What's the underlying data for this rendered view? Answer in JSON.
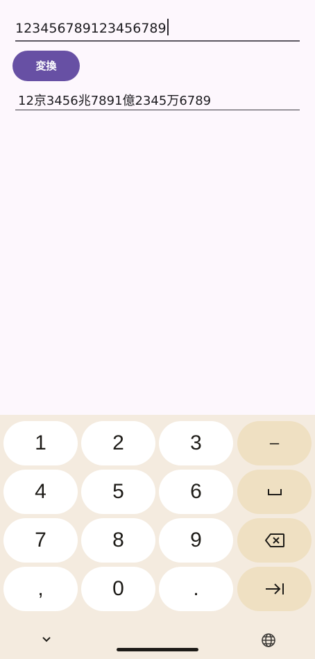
{
  "app": {
    "input_value": "123456789123456789",
    "convert_label": "変換",
    "output_value": "12京3456兆7891億2345万6789"
  },
  "keyboard": {
    "rows": [
      [
        "1",
        "2",
        "3",
        "−"
      ],
      [
        "4",
        "5",
        "6",
        "␣"
      ],
      [
        "7",
        "8",
        "9",
        "backspace"
      ],
      [
        ",",
        "0",
        ".",
        "tab"
      ]
    ],
    "key_1": "1",
    "key_2": "2",
    "key_3": "3",
    "key_minus": "–",
    "key_4": "4",
    "key_5": "5",
    "key_6": "6",
    "key_space": "␣",
    "key_7": "7",
    "key_8": "8",
    "key_9": "9",
    "key_comma": ",",
    "key_0": "0",
    "key_period": ".",
    "icons": {
      "backspace": "backspace-icon",
      "next": "tab-next-icon",
      "hide": "chevron-down-icon",
      "language": "globe-icon"
    }
  },
  "colors": {
    "accent": "#6750a4",
    "keyboard_bg": "#f4ebdf",
    "function_key": "#efe0c2",
    "key": "#ffffff"
  }
}
